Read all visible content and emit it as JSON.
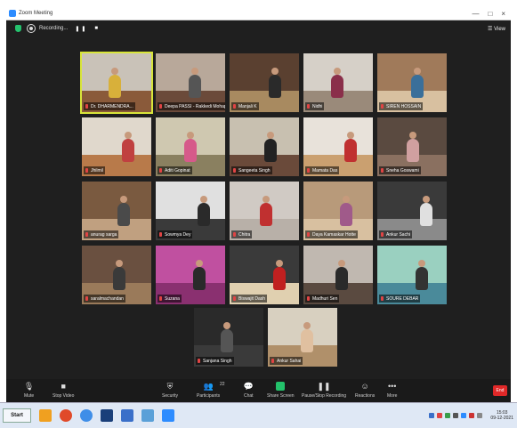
{
  "window": {
    "title": "Zoom Meeting",
    "min": "—",
    "max": "□",
    "close": "×"
  },
  "recording": {
    "label": "Recording...",
    "pause": "❚❚",
    "stop": "■"
  },
  "view_button": "☰ View",
  "participants": [
    {
      "name": "Dr. DHARMENDRA..."
    },
    {
      "name": "Deepa PASSI - Rakkedi Mohap..."
    },
    {
      "name": "Manjali K"
    },
    {
      "name": "Nidhi"
    },
    {
      "name": "SIREN HOSSAIN"
    },
    {
      "name": "Jhilmil"
    },
    {
      "name": "Aditi Gopinat"
    },
    {
      "name": "Sangeeta Singh"
    },
    {
      "name": "Mamata Das"
    },
    {
      "name": "Sneha Goswami"
    },
    {
      "name": "anurag sarga"
    },
    {
      "name": "Sowmya Dey"
    },
    {
      "name": "Chitra"
    },
    {
      "name": "Daya Kamaskar Hotte"
    },
    {
      "name": "Ankur Sachi"
    },
    {
      "name": "saralmachandan"
    },
    {
      "name": "Suzana"
    },
    {
      "name": "Biswajit Dash"
    },
    {
      "name": "Madhuri Sen"
    },
    {
      "name": "SOURE DEBAR"
    },
    {
      "name": "Sanjana Singh"
    },
    {
      "name": "Ankur Sahai"
    }
  ],
  "toolbar": {
    "mute": "Mute",
    "stop_video": "Stop Video",
    "security": "Security",
    "participants": "Participants",
    "participants_count": "22",
    "chat": "Chat",
    "share_screen": "Share Screen",
    "record": "Pause/Stop Recording",
    "reactions": "Reactions",
    "more": "More",
    "end": "End"
  },
  "taskbar": {
    "start": "Start",
    "time": "15:03",
    "date": "09-12-2021"
  },
  "colors": {
    "accent": "#2d8cff",
    "active_speaker": "#d8e53a",
    "end": "#e02828",
    "share": "#23c26b"
  },
  "icons": [
    "zoom-app-icon",
    "shield-icon",
    "record-icon",
    "view-icon",
    "mic-icon",
    "video-icon",
    "security-icon",
    "participants-icon",
    "chat-icon",
    "share-screen-icon",
    "record-stop-icon",
    "reactions-icon",
    "more-icon"
  ]
}
